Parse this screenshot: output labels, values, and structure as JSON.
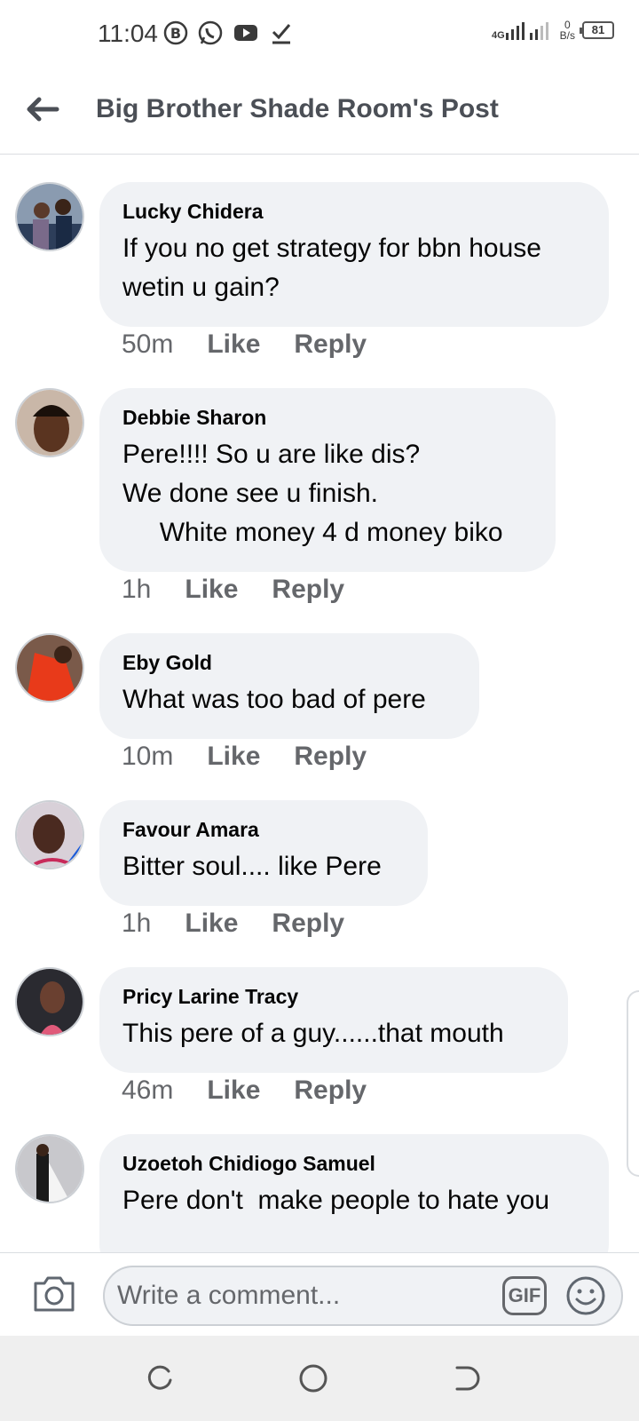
{
  "status_bar": {
    "time": "11:04",
    "network": "4G",
    "speed_value": "0",
    "speed_unit": "B/s",
    "battery": "81"
  },
  "header": {
    "title": "Big Brother Shade Room's Post"
  },
  "comments": [
    {
      "author": "Lucky Chidera",
      "text": "If you no get strategy for bbn house\nwetin u gain?",
      "time": "50m",
      "like_label": "Like",
      "reply_label": "Reply"
    },
    {
      "author": "Debbie Sharon",
      "text": "Pere!!!! So u are like dis?\nWe done see u finish.\n     White money 4 d money biko",
      "time": "1h",
      "like_label": "Like",
      "reply_label": "Reply"
    },
    {
      "author": "Eby Gold",
      "text": "What was too bad of pere",
      "time": "10m",
      "like_label": "Like",
      "reply_label": "Reply"
    },
    {
      "author": "Favour Amara",
      "text": "Bitter soul.... like Pere",
      "time": "1h",
      "like_label": "Like",
      "reply_label": "Reply"
    },
    {
      "author": "Pricy Larine Tracy",
      "text": "This pere of a guy......that mouth",
      "time": "46m",
      "like_label": "Like",
      "reply_label": "Reply"
    },
    {
      "author": "Uzoetoh Chidiogo Samuel",
      "text": "Pere don't  make people to hate you",
      "time": "",
      "like_label": "",
      "reply_label": ""
    }
  ],
  "composer": {
    "placeholder": "Write a comment...",
    "gif_label": "GIF"
  },
  "colors": {
    "bubble": "#f0f2f5",
    "meta_text": "#65676b",
    "header_text": "#4b4f56"
  }
}
